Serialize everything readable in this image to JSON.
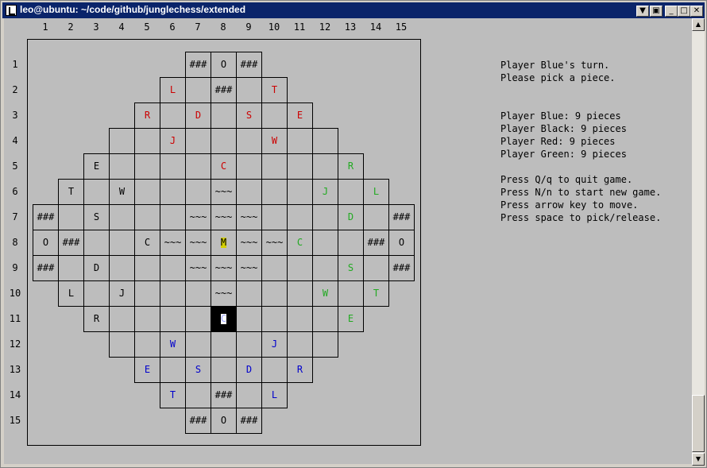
{
  "window": {
    "title": "leo@ubuntu: ~/code/github/junglechess/extended",
    "buttons": [
      {
        "name": "restore-down-button",
        "glyph": "▼"
      },
      {
        "name": "menu-button",
        "glyph": "▣"
      },
      {
        "name": "minimize-button",
        "glyph": "_"
      },
      {
        "name": "maximize-button",
        "glyph": "□"
      },
      {
        "name": "close-button",
        "glyph": "✕"
      }
    ]
  },
  "scrollbar": {
    "up_glyph": "▲",
    "down_glyph": "▼"
  },
  "board": {
    "column_labels": [
      "1",
      "2",
      "3",
      "4",
      "5",
      "6",
      "7",
      "8",
      "9",
      "10",
      "11",
      "12",
      "13",
      "14",
      "15"
    ],
    "row_labels": [
      "1",
      "2",
      "3",
      "4",
      "5",
      "6",
      "7",
      "8",
      "9",
      "10",
      "11",
      "12",
      "13",
      "14",
      "15"
    ],
    "colors": {
      "red": "#cc0000",
      "black": "#000000",
      "green": "#22aa22",
      "blue": "#0000cc",
      "highlight": "#d4d000"
    },
    "rows": [
      [
        "",
        "",
        "",
        "",
        "",
        "",
        "###",
        "O",
        "###",
        "",
        "",
        "",
        "",
        "",
        ""
      ],
      [
        "",
        "",
        "",
        "",
        "",
        "L",
        "",
        "###",
        "",
        "T",
        "",
        "",
        "",
        "",
        ""
      ],
      [
        "",
        "",
        "",
        "",
        "R",
        "",
        "D",
        "",
        "S",
        "",
        "E",
        "",
        "",
        "",
        ""
      ],
      [
        "",
        "",
        "",
        "",
        "",
        "J",
        "",
        "",
        "",
        "W",
        "",
        "",
        "",
        "",
        ""
      ],
      [
        "",
        "",
        "E",
        "",
        "",
        "",
        "",
        "C",
        "",
        "",
        "",
        "",
        "R",
        "",
        ""
      ],
      [
        "",
        "T",
        "",
        "W",
        "",
        "",
        "",
        "~~~",
        "",
        "",
        "",
        "J",
        "",
        "L",
        ""
      ],
      [
        "###",
        "",
        "S",
        "",
        "",
        "",
        "~~~",
        "~~~",
        "~~~",
        "",
        "",
        "",
        "D",
        "",
        "###"
      ],
      [
        "O",
        "###",
        "",
        "",
        "C",
        "~~~",
        "~~~",
        "M",
        "~~~",
        "~~~",
        "C",
        "",
        "",
        "###",
        "O"
      ],
      [
        "###",
        "",
        "D",
        "",
        "",
        "",
        "~~~",
        "~~~",
        "~~~",
        "",
        "",
        "",
        "S",
        "",
        "###"
      ],
      [
        "",
        "L",
        "",
        "J",
        "",
        "",
        "",
        "~~~",
        "",
        "",
        "",
        "W",
        "",
        "T",
        ""
      ],
      [
        "",
        "",
        "R",
        "",
        "",
        "",
        "",
        "C",
        "",
        "",
        "",
        "",
        "E",
        "",
        ""
      ],
      [
        "",
        "",
        "",
        "",
        "",
        "W",
        "",
        "",
        "",
        "J",
        "",
        "",
        "",
        "",
        ""
      ],
      [
        "",
        "",
        "",
        "",
        "E",
        "",
        "S",
        "",
        "D",
        "",
        "R",
        "",
        "",
        "",
        ""
      ],
      [
        "",
        "",
        "",
        "",
        "",
        "T",
        "",
        "###",
        "",
        "L",
        "",
        "",
        "",
        "",
        ""
      ],
      [
        "",
        "",
        "",
        "",
        "",
        "",
        "###",
        "O",
        "###",
        "",
        "",
        "",
        "",
        "",
        ""
      ]
    ],
    "piece_colors": [
      [
        "",
        "",
        "",
        "",
        "",
        "",
        "",
        "",
        "",
        "",
        "",
        "",
        "",
        "",
        ""
      ],
      [
        "",
        "",
        "",
        "",
        "",
        "red",
        "",
        "",
        "",
        "red",
        "",
        "",
        "",
        "",
        ""
      ],
      [
        "",
        "",
        "",
        "",
        "red",
        "",
        "red",
        "",
        "red",
        "",
        "red",
        "",
        "",
        "",
        ""
      ],
      [
        "",
        "",
        "",
        "",
        "",
        "red",
        "",
        "",
        "",
        "red",
        "",
        "",
        "",
        "",
        ""
      ],
      [
        "",
        "",
        "black",
        "",
        "",
        "",
        "",
        "red",
        "",
        "",
        "",
        "",
        "green",
        "",
        ""
      ],
      [
        "",
        "black",
        "",
        "black",
        "",
        "",
        "",
        "",
        "",
        "",
        "",
        "green",
        "",
        "green",
        ""
      ],
      [
        "",
        "",
        "black",
        "",
        "",
        "",
        "",
        "",
        "",
        "",
        "",
        "",
        "green",
        "",
        ""
      ],
      [
        "",
        "",
        "",
        "",
        "black",
        "",
        "",
        "",
        "",
        "",
        "green",
        "",
        "",
        "",
        ""
      ],
      [
        "",
        "",
        "black",
        "",
        "",
        "",
        "",
        "",
        "",
        "",
        "",
        "",
        "green",
        "",
        ""
      ],
      [
        "",
        "black",
        "",
        "black",
        "",
        "",
        "",
        "",
        "",
        "",
        "",
        "green",
        "",
        "green",
        ""
      ],
      [
        "",
        "",
        "black",
        "",
        "",
        "",
        "",
        "blue",
        "",
        "",
        "",
        "",
        "green",
        "",
        ""
      ],
      [
        "",
        "",
        "",
        "",
        "",
        "blue",
        "",
        "",
        "",
        "blue",
        "",
        "",
        "",
        "",
        ""
      ],
      [
        "",
        "",
        "",
        "",
        "blue",
        "",
        "blue",
        "",
        "blue",
        "",
        "blue",
        "",
        "",
        "",
        ""
      ],
      [
        "",
        "",
        "",
        "",
        "",
        "blue",
        "",
        "",
        "",
        "blue",
        "",
        "",
        "",
        "",
        ""
      ],
      [
        "",
        "",
        "",
        "",
        "",
        "",
        "",
        "",
        "",
        "",
        "",
        "",
        "",
        "",
        ""
      ]
    ],
    "highlighted_cell": {
      "row": 8,
      "col": 8
    },
    "cursor_cell": {
      "row": 11,
      "col": 8
    }
  },
  "info": {
    "lines": [
      "Player Blue's turn.",
      "Please pick a piece.",
      "",
      "",
      "Player Blue: 9 pieces",
      "Player Black: 9 pieces",
      "Player Red: 9 pieces",
      "Player Green: 9 pieces",
      "",
      "Press Q/q to quit game.",
      "Press N/n to start new game.",
      "Press arrow key to move.",
      "Press space to pick/release."
    ]
  }
}
